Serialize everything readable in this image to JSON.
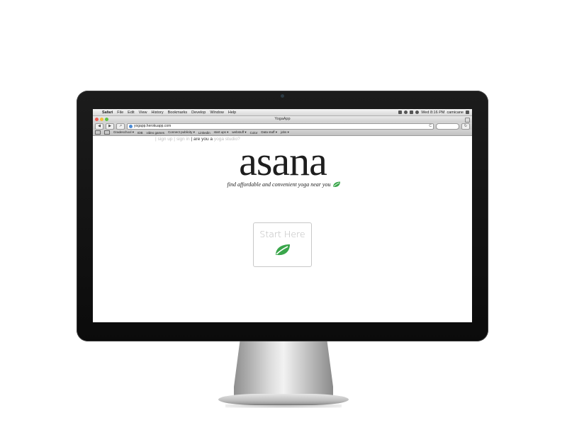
{
  "menubar": {
    "app_name": "Safari",
    "items": [
      "File",
      "Edit",
      "View",
      "History",
      "Bookmarks",
      "Develop",
      "Window",
      "Help"
    ],
    "clock": "Wed 8:16 PM",
    "user": "camicane"
  },
  "browser": {
    "window_title": "YogaApp",
    "url": "yogapp.herokuapp.com",
    "bookmarks": [
      "Gradeschool ▾",
      "IDB",
      "video games",
      "Connect publicity ▾",
      "Linkedin",
      "start ups ▾",
      "webstuff ▾",
      "Color",
      "Data stuff ▾",
      "jobs ▾"
    ]
  },
  "page": {
    "links": {
      "sep_open": "|",
      "sign_up": "sign up",
      "sep_mid": "|",
      "sign_in": "sign in",
      "sep_close": "|",
      "studio_prompt": "are you a",
      "studio_link": "yoga studio?"
    },
    "logo_text": "asana",
    "tagline": "find affordable and convenient yoga near you",
    "start_button_label": "Start Here",
    "leaf_icon_color": "#3aa64b"
  },
  "colors": {
    "accent_leaf": "#3aa64b",
    "logo_text": "#1e1e1e",
    "muted_link": "#bbbbbb"
  }
}
